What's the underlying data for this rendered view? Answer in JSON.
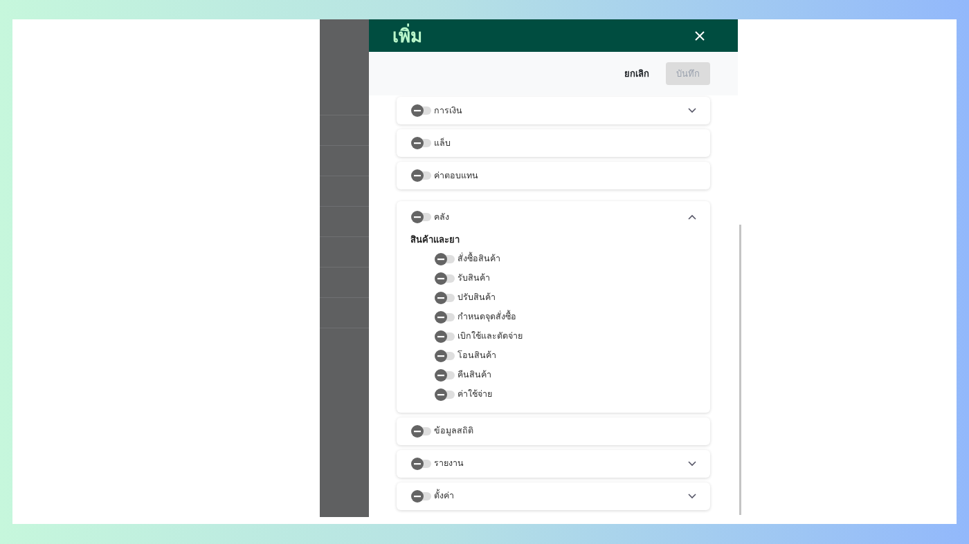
{
  "modal": {
    "title": "เพิ่ม",
    "actions": [
      {
        "kind": "text",
        "label": "ยกเลิก"
      },
      {
        "kind": "filled",
        "label": "บันทึก",
        "disabled": true
      }
    ],
    "permissions": [
      {
        "label": "การเงิน",
        "indeterminate": true,
        "expanded": false
      },
      {
        "label": "แล็บ",
        "indeterminate": true
      },
      {
        "label": "ค่าตอบแทน",
        "indeterminate": true
      },
      {
        "label": "คลัง",
        "indeterminate": true,
        "expanded": true,
        "groups": [
          {
            "title": "สินค้าและยา",
            "items": [
              {
                "label": "สั่งซื้อสินค้า",
                "indeterminate": true
              },
              {
                "label": "รับสินค้า",
                "indeterminate": true
              },
              {
                "label": "ปรับสินค้า",
                "indeterminate": true
              },
              {
                "label": "กำหนดจุดสั่งซื้อ",
                "indeterminate": true
              },
              {
                "label": "เบิกใช้และตัดจ่าย",
                "indeterminate": true
              },
              {
                "label": "โอนสินค้า",
                "indeterminate": true
              },
              {
                "label": "คืนสินค้า",
                "indeterminate": true
              },
              {
                "label": "ค่าใช้จ่าย",
                "indeterminate": true
              }
            ]
          }
        ]
      },
      {
        "label": "ข้อมูลสถิติ",
        "indeterminate": true
      },
      {
        "label": "รายงาน",
        "indeterminate": true,
        "expanded": false
      },
      {
        "label": "ตั้งค่า",
        "indeterminate": true,
        "expanded": false
      }
    ]
  }
}
